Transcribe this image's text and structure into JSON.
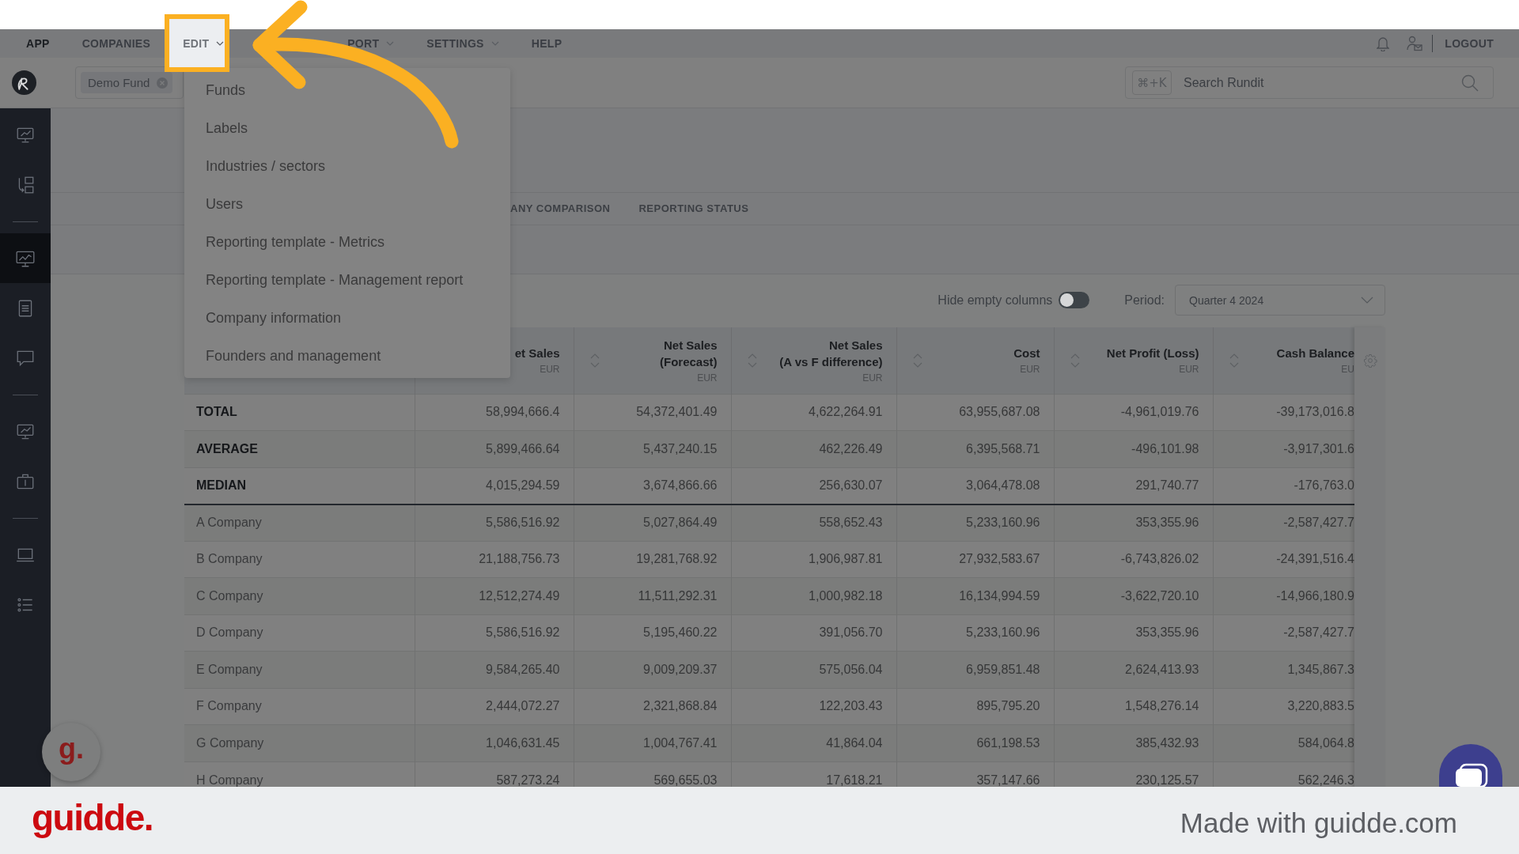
{
  "nav": {
    "items": [
      {
        "label": "APP",
        "selected": true,
        "dropdown": false,
        "highlighted": false
      },
      {
        "label": "COMPANIES",
        "selected": false,
        "dropdown": false,
        "highlighted": false
      },
      {
        "label": "EDIT",
        "selected": false,
        "dropdown": true,
        "highlighted": true
      },
      {
        "label": "PORT",
        "selected": false,
        "dropdown": true,
        "highlighted": false
      },
      {
        "label": "SETTINGS",
        "selected": false,
        "dropdown": true,
        "highlighted": false
      },
      {
        "label": "HELP",
        "selected": false,
        "dropdown": false,
        "highlighted": false
      }
    ],
    "logout": "LOGOUT"
  },
  "toolbar": {
    "fund_chip": "Demo Fund",
    "search": {
      "shortcut": "⌘+K",
      "placeholder": "Search Rundit"
    }
  },
  "sidebar": {
    "groups": [
      [
        {
          "kind": "chart-monitor",
          "selected": false
        },
        {
          "kind": "arrow-boxes",
          "selected": false
        }
      ],
      [
        {
          "kind": "trend-monitor",
          "selected": true
        },
        {
          "kind": "document",
          "selected": false
        },
        {
          "kind": "chat",
          "selected": false
        }
      ],
      [
        {
          "kind": "chart-monitor",
          "selected": false
        },
        {
          "kind": "briefcase",
          "selected": false
        }
      ],
      [
        {
          "kind": "laptop",
          "selected": false
        },
        {
          "kind": "list",
          "selected": false
        }
      ]
    ]
  },
  "edit_menu": {
    "items": [
      "Funds",
      "Labels",
      "Industries / sectors",
      "Users",
      "Reporting template - Metrics",
      "Reporting template - Management report",
      "Company information",
      "Founders and management"
    ]
  },
  "tabs": [
    {
      "label": "ANY COMPARISON",
      "selected": false
    },
    {
      "label": "REPORTING STATUS",
      "selected": false
    }
  ],
  "controls": {
    "hide_empty": {
      "label": "Hide empty columns",
      "on": false
    },
    "period": {
      "label": "Period:",
      "value": "Quarter 4 2024"
    }
  },
  "table": {
    "columns": [
      {
        "title_lines": [
          "et Sales"
        ],
        "unit": "EUR"
      },
      {
        "title_lines": [
          "Net Sales",
          "(Forecast)"
        ],
        "unit": "EUR",
        "sortable": true
      },
      {
        "title_lines": [
          "Net Sales",
          "(A vs F difference)"
        ],
        "unit": "EUR",
        "sortable": true
      },
      {
        "title_lines": [
          "Cost"
        ],
        "unit": "EUR",
        "sortable": true
      },
      {
        "title_lines": [
          "Net Profit (Loss)"
        ],
        "unit": "EUR",
        "sortable": true
      },
      {
        "title_lines": [
          "Cash Balance"
        ],
        "unit": "EU",
        "sortable": true
      }
    ],
    "rows": [
      {
        "kind": "summary",
        "label": "TOTAL",
        "values": [
          "58,994,666.4",
          "54,372,401.49",
          "4,622,264.91",
          "63,955,687.08",
          "-4,961,019.76",
          "-39,173,016.8"
        ]
      },
      {
        "kind": "summary",
        "label": "AVERAGE",
        "values": [
          "5,899,466.64",
          "5,437,240.15",
          "462,226.49",
          "6,395,568.71",
          "-496,101.98",
          "-3,917,301.6"
        ]
      },
      {
        "kind": "summary",
        "label": "MEDIAN",
        "values": [
          "4,015,294.59",
          "3,674,866.66",
          "256,630.07",
          "3,064,478.08",
          "291,740.77",
          "-176,763.0"
        ]
      },
      {
        "kind": "company",
        "label": "A Company",
        "values": [
          "5,586,516.92",
          "5,027,864.49",
          "558,652.43",
          "5,233,160.96",
          "353,355.96",
          "-2,587,427.7"
        ]
      },
      {
        "kind": "company",
        "label": "B Company",
        "values": [
          "21,188,756.73",
          "19,281,768.92",
          "1,906,987.81",
          "27,932,583.67",
          "-6,743,826.02",
          "-24,391,516.4"
        ]
      },
      {
        "kind": "company",
        "label": "C Company",
        "values": [
          "12,512,274.49",
          "11,511,292.31",
          "1,000,982.18",
          "16,134,994.59",
          "-3,622,720.10",
          "-14,966,180.9"
        ]
      },
      {
        "kind": "company",
        "label": "D Company",
        "values": [
          "5,586,516.92",
          "5,195,460.22",
          "391,056.70",
          "5,233,160.96",
          "353,355.96",
          "-2,587,427.7"
        ]
      },
      {
        "kind": "company",
        "label": "E Company",
        "values": [
          "9,584,265.40",
          "9,009,209.37",
          "575,056.04",
          "6,959,851.48",
          "2,624,413.93",
          "1,345,867.3"
        ]
      },
      {
        "kind": "company",
        "label": "F Company",
        "values": [
          "2,444,072.27",
          "2,321,868.84",
          "122,203.43",
          "895,795.20",
          "1,548,276.14",
          "3,220,883.5"
        ]
      },
      {
        "kind": "company",
        "label": "G Company",
        "values": [
          "1,046,631.45",
          "1,004,767.41",
          "41,864.04",
          "661,198.53",
          "385,432.93",
          "584,064.8"
        ]
      },
      {
        "kind": "company",
        "label": "H Company",
        "values": [
          "587,273.24",
          "569,655.03",
          "17,618.21",
          "357,147.66",
          "230,125.57",
          "562,246.3"
        ]
      }
    ]
  },
  "guidde": {
    "widget": "g.",
    "logo": "guidde.",
    "credit": "Made with guidde.com"
  }
}
